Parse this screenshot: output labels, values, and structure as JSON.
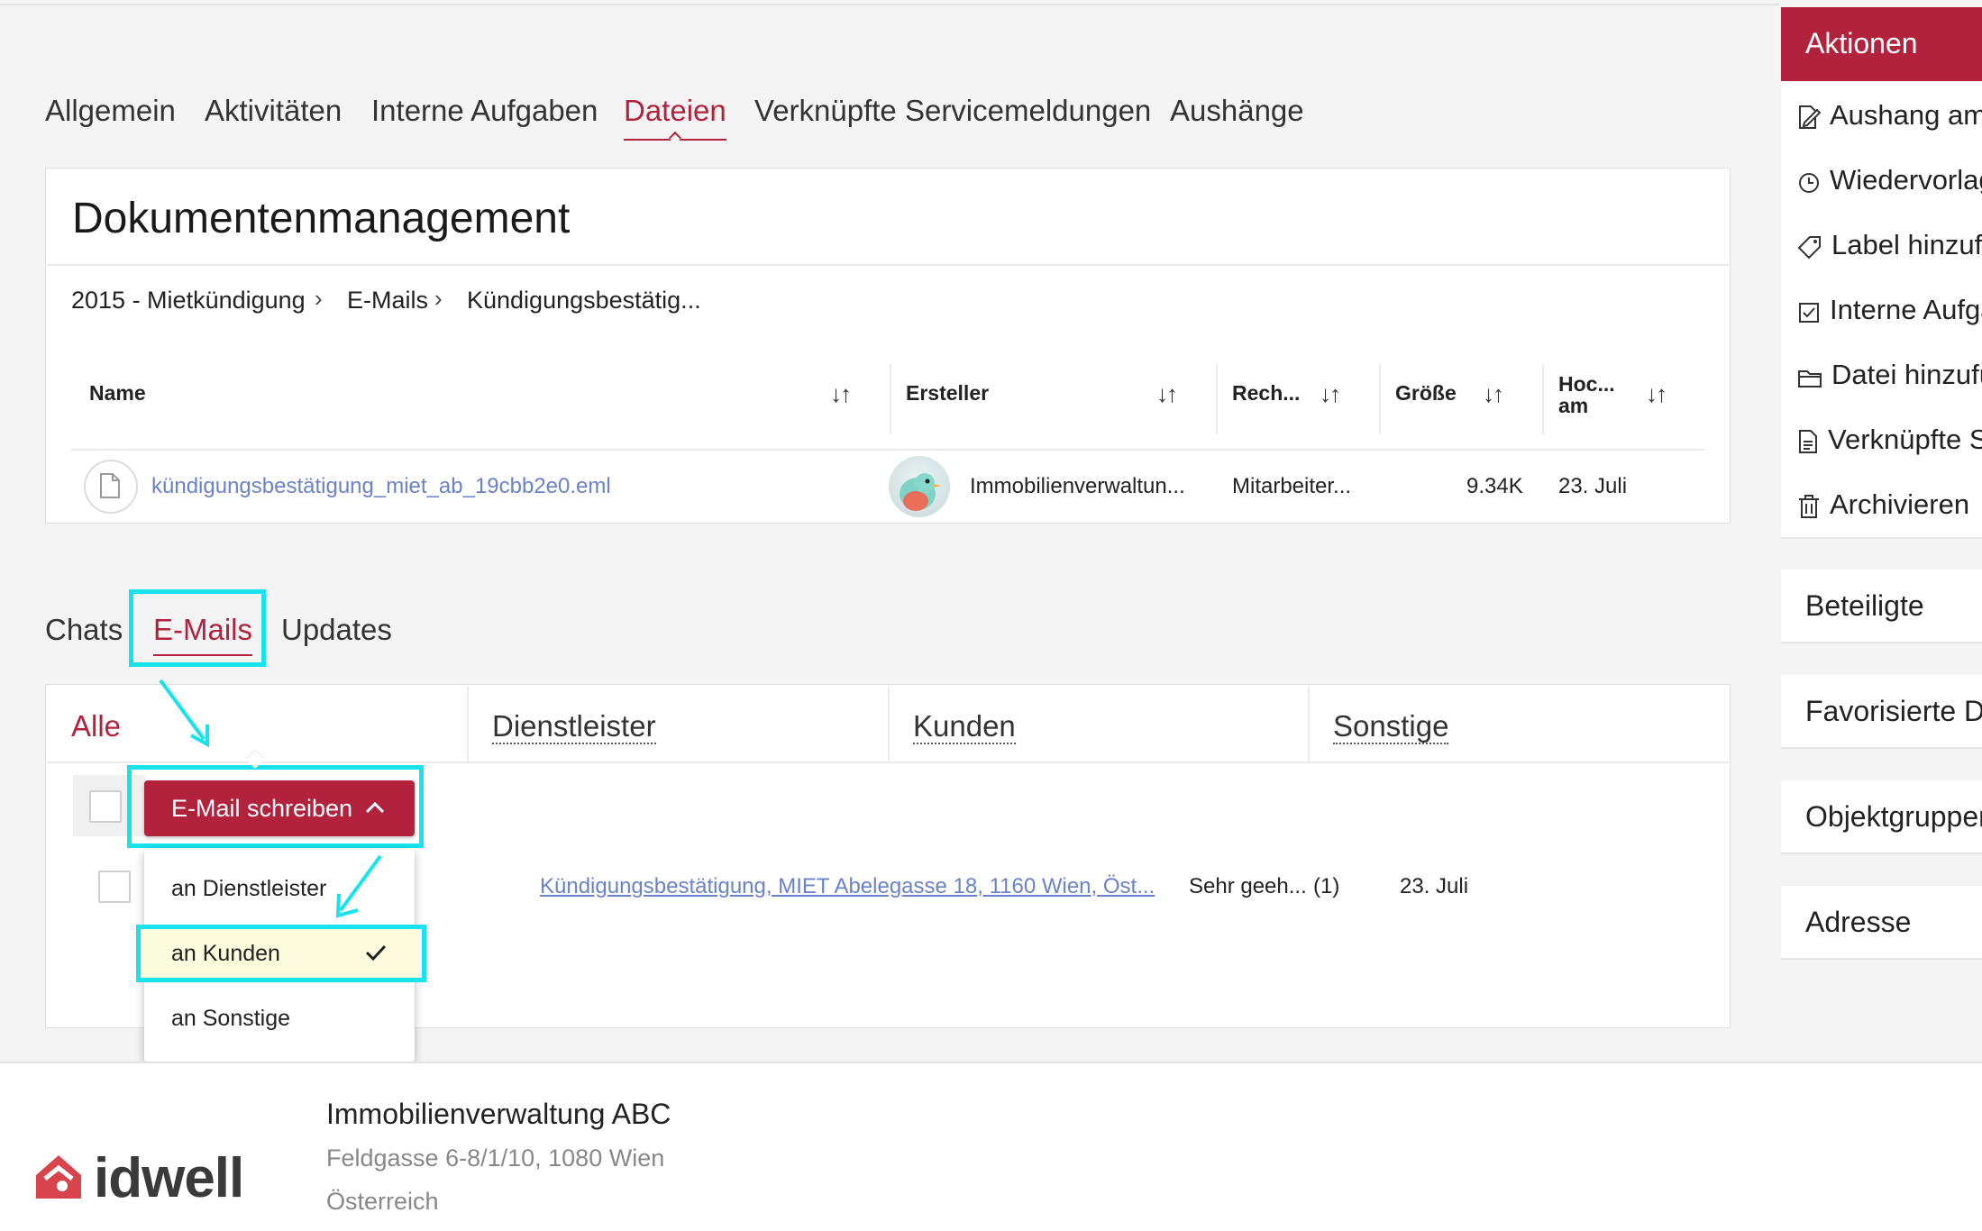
{
  "tabs": [
    "Allgemein",
    "Aktivitäten",
    "Interne Aufgaben",
    "Dateien",
    "Verknüpfte Servicemeldungen",
    "Aushänge"
  ],
  "active_tab": "Dateien",
  "documents": {
    "title": "Dokumentenmanagement",
    "breadcrumb": [
      "2015 - Mietkündigung",
      "E-Mails",
      "Kündigungsbestätig..."
    ],
    "columns": [
      "Name",
      "Ersteller",
      "Rech...",
      "Größe",
      "Hoc... am"
    ],
    "rows": [
      {
        "name": "kündigungsbestätigung_miet_ab_19cbb2e0.eml",
        "creator": "Immobilienverwaltun...",
        "rights": "Mitarbeiter...",
        "size": "9.34K",
        "date": "23. Juli"
      }
    ]
  },
  "comm_tabs": [
    "Chats",
    "E-Mails",
    "Updates"
  ],
  "active_comm_tab": "E-Mails",
  "email_filters": [
    "Alle",
    "Dienstleister",
    "Kunden",
    "Sonstige"
  ],
  "active_filter": "Alle",
  "compose_button": "E-Mail schreiben",
  "compose_menu": [
    "an Dienstleister",
    "an Kunden",
    "an Sonstige"
  ],
  "compose_selected": "an Kunden",
  "email_row": {
    "subject": "Kündigungsbestätigung, MIET Abelegasse 18, 1160 Wien, Öst...",
    "preview": "Sehr geeh...",
    "count": "(1)",
    "date": "23. Juli"
  },
  "sidebar": {
    "header": "Aktionen",
    "actions": [
      {
        "icon": "edit-document-icon",
        "label": "Aushang am"
      },
      {
        "icon": "clock-icon",
        "label": "Wiedervorlag"
      },
      {
        "icon": "tag-icon",
        "label": "Label hinzufü"
      },
      {
        "icon": "checkbox-icon",
        "label": "Interne Aufga"
      },
      {
        "icon": "folder-icon",
        "label": "Datei hinzufü"
      },
      {
        "icon": "document-icon",
        "label": "Verknüpfte S"
      },
      {
        "icon": "trash-icon",
        "label": "Archivieren"
      }
    ],
    "sections": [
      "Beteiligte",
      "Favorisierte D",
      "Objektgruppen",
      "Adresse"
    ]
  },
  "footer": {
    "company": "Immobilienverwaltung ABC",
    "address": "Feldgasse 6-8/1/10, 1080 Wien",
    "country": "Österreich",
    "logo_text": "idwell"
  },
  "colors": {
    "accent": "#b3223c",
    "highlight": "#17e3ee",
    "link": "#6a82c9"
  }
}
